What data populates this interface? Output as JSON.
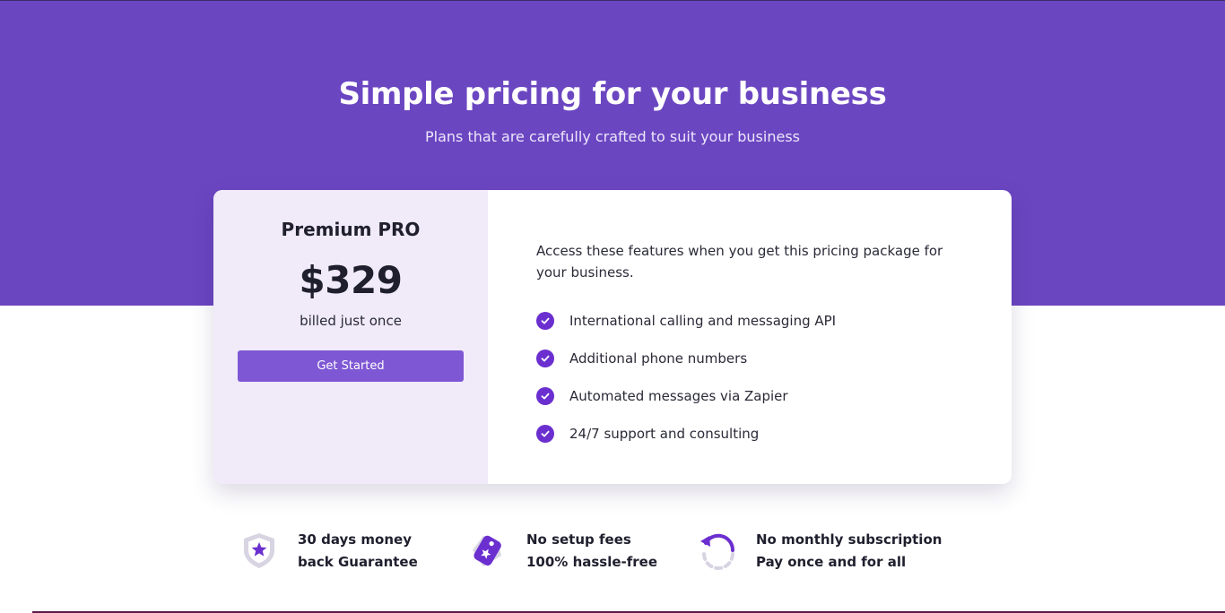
{
  "hero": {
    "title": "Simple pricing for your business",
    "subtitle": "Plans that are carefully crafted to suit your business"
  },
  "plan": {
    "name": "Premium PRO",
    "price": "$329",
    "billing": "billed just once",
    "cta_label": "Get Started"
  },
  "features": {
    "intro": "Access these features when you get this pricing package for your business.",
    "items": [
      {
        "label": "International calling and messaging API",
        "icon": "check-icon"
      },
      {
        "label": "Additional phone numbers",
        "icon": "check-icon"
      },
      {
        "label": "Automated messages via Zapier",
        "icon": "check-icon"
      },
      {
        "label": "24/7 support and consulting",
        "icon": "check-icon"
      }
    ]
  },
  "guarantees": [
    {
      "label": "30 days money back Guarantee",
      "icon": "shield-star-icon"
    },
    {
      "label": "No setup fees 100% hassle-free",
      "icon": "price-tag-icon"
    },
    {
      "label": "No monthly subscription Pay once and for all",
      "icon": "refresh-icon"
    }
  ],
  "colors": {
    "hero_bg": "#6b46c1",
    "accent": "#6b2fd0",
    "button": "#7e57d4",
    "plan_panel_bg": "#f0eaf9"
  }
}
